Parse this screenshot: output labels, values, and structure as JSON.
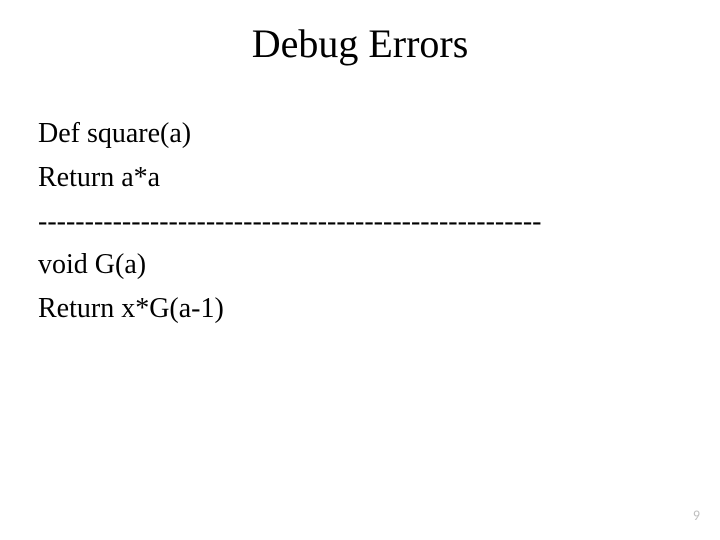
{
  "title": "Debug Errors",
  "body": {
    "line1": "Def square(a)",
    "line2": "Return a*a",
    "separator": "------------------------------------------------------",
    "line3": "void G(a)",
    "line4": "Return x*G(a-1)"
  },
  "page_number": "9"
}
